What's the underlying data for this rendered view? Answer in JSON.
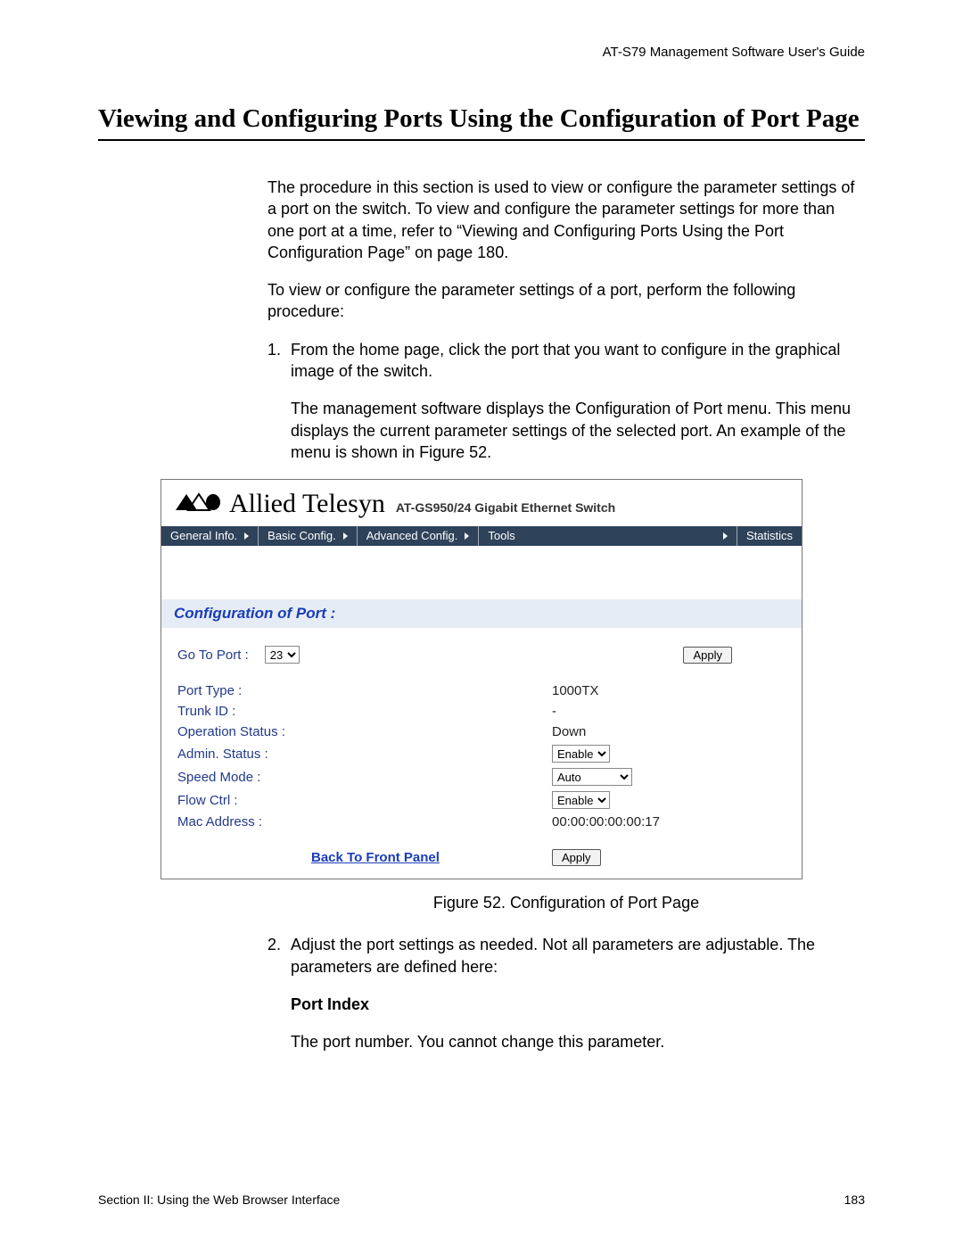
{
  "doc_header": "AT-S79 Management Software User's Guide",
  "page_title": "Viewing and Configuring Ports Using the Configuration of Port Page",
  "intro_p1": "The procedure in this section is used to view or configure the parameter settings of a port on the switch. To view and configure the parameter settings for more than one port at a time, refer to “Viewing and Configuring Ports Using the Port Configuration Page” on page 180.",
  "intro_p2": "To view or configure the parameter settings of a port, perform the following procedure:",
  "step1_num": "1.",
  "step1": "From the home page, click the port that you want to configure in the graphical image of the switch.",
  "step1_sub": "The management software displays the Configuration of Port menu. This menu displays the current parameter settings of the selected port. An example of the menu is shown in Figure 52.",
  "figure": {
    "brand": "Allied Telesyn",
    "brand_sub": "AT-GS950/24 Gigabit Ethernet Switch",
    "menu": [
      "General Info.",
      "Basic Config.",
      "Advanced Config.",
      "Tools",
      "Statistics"
    ],
    "panel_title": "Configuration of Port :",
    "goto_label": "Go To Port :",
    "goto_value": "23",
    "apply_label": "Apply",
    "rows": {
      "port_type_label": "Port Type :",
      "port_type_value": "1000TX",
      "trunk_id_label": "Trunk ID :",
      "trunk_id_value": "-",
      "op_status_label": "Operation Status :",
      "op_status_value": "Down",
      "admin_status_label": "Admin. Status :",
      "admin_status_value": "Enable",
      "speed_label": "Speed Mode :",
      "speed_value": "Auto",
      "flow_label": "Flow Ctrl :",
      "flow_value": "Enable",
      "mac_label": "Mac Address :",
      "mac_value": "00:00:00:00:00:17"
    },
    "back_link": "Back To Front Panel"
  },
  "figure_caption": "Figure 52. Configuration of Port Page",
  "step2_num": "2.",
  "step2": "Adjust the port settings as needed. Not all parameters are adjustable. The parameters are defined here:",
  "param_head": "Port Index",
  "param_text": "The port number. You cannot change this parameter.",
  "footer_left": "Section II: Using the Web Browser Interface",
  "footer_right": "183"
}
